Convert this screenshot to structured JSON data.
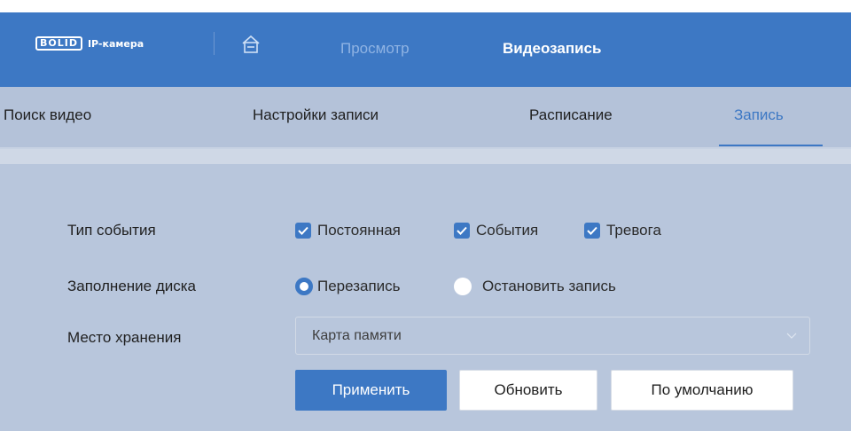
{
  "header": {
    "brand_logo": "BOLID",
    "brand_text": "IP-камера",
    "nav": {
      "preview": "Просмотр",
      "recording": "Видеозапись"
    },
    "icons": {
      "home": "home-icon"
    }
  },
  "subnav": {
    "items": [
      "Поиск видео",
      "Настройки записи",
      "Расписание",
      "Запись"
    ],
    "active": "Запись"
  },
  "form": {
    "event_type": {
      "label": "Тип события",
      "options": [
        {
          "label": "Постоянная",
          "checked": true
        },
        {
          "label": "События",
          "checked": true
        },
        {
          "label": "Тревога",
          "checked": true
        }
      ]
    },
    "disk_full": {
      "label": "Заполнение диска",
      "options": [
        {
          "label": "Перезапись",
          "selected": true
        },
        {
          "label": "Остановить запись",
          "selected": false
        }
      ]
    },
    "storage": {
      "label": "Место хранения",
      "value": "Карта памяти"
    },
    "buttons": {
      "apply": "Применить",
      "refresh": "Обновить",
      "default": "По умолчанию"
    }
  },
  "colors": {
    "accent": "#3d78c4",
    "background": "#b8c6dc",
    "text": "#1f1f1f"
  }
}
